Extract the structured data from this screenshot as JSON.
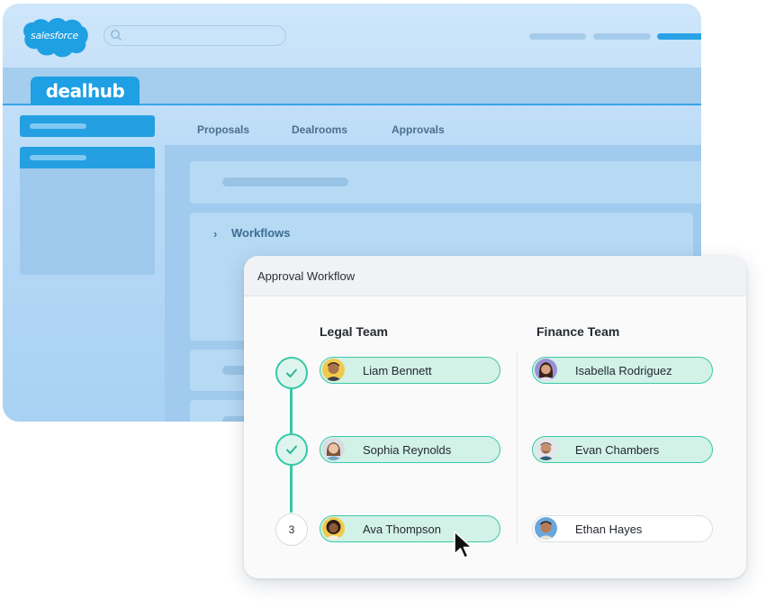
{
  "salesforce": {
    "logo_text": "salesforce",
    "app_tab": "dealhub",
    "nav": [
      "Proposals",
      "Dealrooms",
      "Approvals"
    ],
    "section": "Workflows"
  },
  "workflow": {
    "title": "Approval Workflow",
    "legal_title": "Legal Team",
    "finance_title": "Finance Team",
    "steps": [
      {
        "status": "done",
        "label": ""
      },
      {
        "status": "done",
        "label": ""
      },
      {
        "status": "pending",
        "label": "3"
      }
    ],
    "legal": [
      {
        "name": "Liam Bennett",
        "approved": true
      },
      {
        "name": "Sophia Reynolds",
        "approved": true
      },
      {
        "name": "Ava Thompson",
        "approved": true
      }
    ],
    "finance": [
      {
        "name": "Isabella Rodriguez",
        "approved": true
      },
      {
        "name": "Evan Chambers",
        "approved": true
      },
      {
        "name": "Ethan Hayes",
        "approved": false
      }
    ]
  },
  "colors": {
    "accent": "#35c8a8",
    "approved_bg": "#d2f1e7",
    "salesforce_blue": "#1f9fe4"
  }
}
